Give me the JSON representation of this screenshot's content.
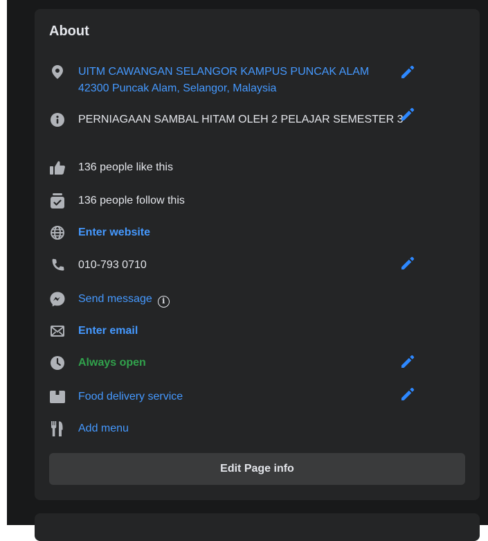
{
  "about": {
    "title": "About",
    "location_line1": "UITM CAWANGAN SELANGOR KAMPUS PUNCAK ALAM",
    "location_line2": "42300 Puncak Alam, Selangor, Malaysia",
    "description": "PERNIAGAAN SAMBAL HITAM OLEH 2 PELAJAR SEMESTER 3",
    "likes": "136 people like this",
    "follows": "136 people follow this",
    "website": "Enter website",
    "phone": "010-793 0710",
    "message": "Send message",
    "email": "Enter email",
    "hours": "Always open",
    "service": "Food delivery service",
    "menu": "Add menu",
    "edit_button": "Edit Page info"
  },
  "colors": {
    "link": "#4599ff",
    "open_green": "#31a24c",
    "card_bg": "#242526",
    "page_bg": "#18191a"
  },
  "icons": [
    "location-pin-icon",
    "info-icon",
    "thumbs-up-icon",
    "follow-icon",
    "globe-icon",
    "phone-icon",
    "messenger-icon",
    "info-circle-icon",
    "envelope-icon",
    "clock-icon",
    "delivery-box-icon",
    "fork-knife-icon",
    "pencil-icon"
  ]
}
